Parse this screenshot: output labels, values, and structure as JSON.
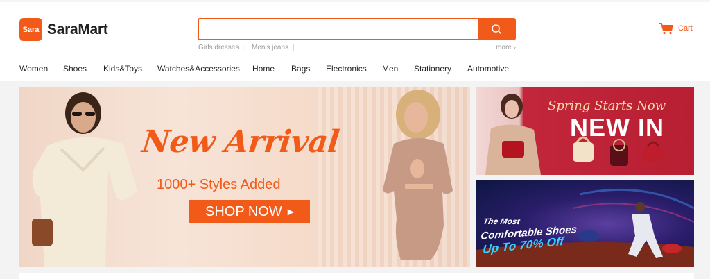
{
  "brand": {
    "badge": "Sara",
    "name": "SaraMart",
    "accent": "#f25a1a"
  },
  "search": {
    "value": "",
    "placeholder": "",
    "icon": "search-icon"
  },
  "hotwords": {
    "items": [
      "Girls dresses",
      "Men's jeans"
    ],
    "more": "more"
  },
  "cart": {
    "label": "Cart",
    "icon": "cart-icon"
  },
  "nav": {
    "items": [
      "Women",
      "Shoes",
      "Kids&Toys",
      "Watches&Accessories",
      "Home",
      "Bags",
      "Electronics",
      "Men",
      "Stationery",
      "Automotive"
    ]
  },
  "banners": {
    "main": {
      "headline": "New Arrival",
      "subline": "1000+ Styles Added",
      "cta": "SHOP NOW"
    },
    "side1": {
      "script": "Spring Starts Now",
      "headline": "NEW IN"
    },
    "side2": {
      "line1": "The Most",
      "line2": "Comfortable Shoes",
      "line3": "Up To 70% Off"
    }
  }
}
